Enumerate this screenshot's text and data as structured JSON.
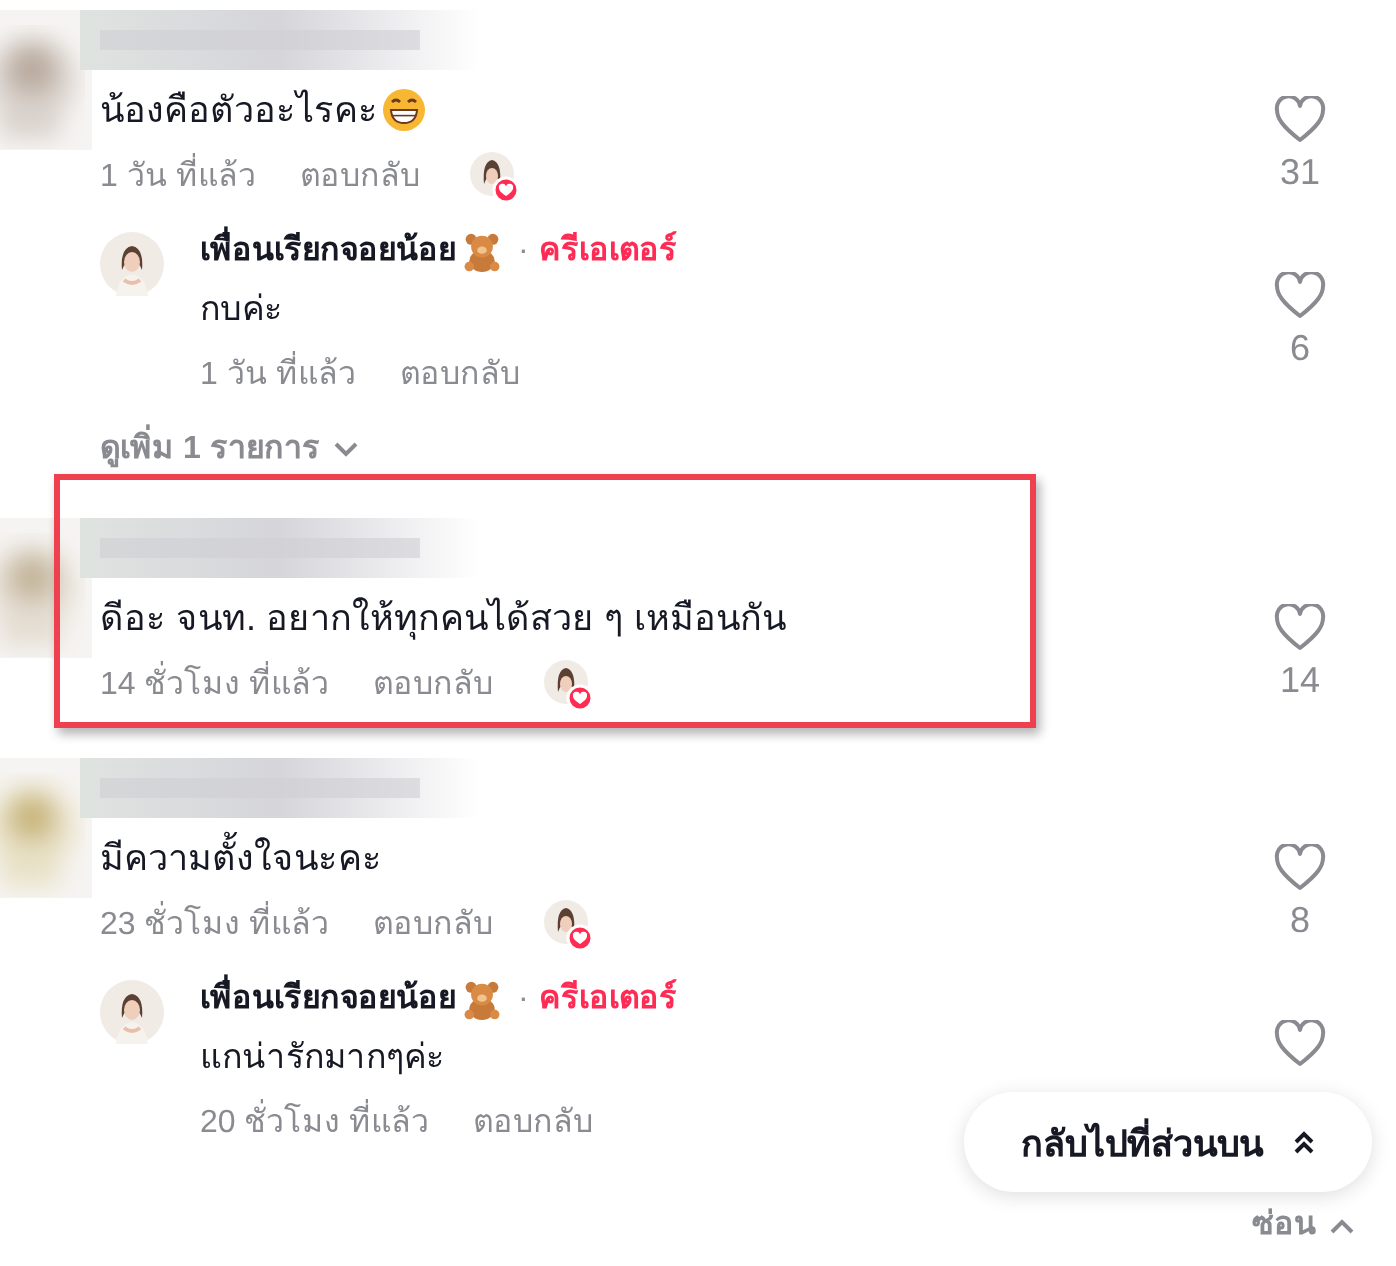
{
  "comments": [
    {
      "text": "น้องคือตัวอะไรคะ",
      "emoji": true,
      "time": "1 วัน ที่แล้ว",
      "reply_label": "ตอบกลับ",
      "liked_by_creator": true,
      "likes": "31",
      "highlighted": false,
      "replies": [
        {
          "author": "เพื่อนเรียกจอยน้อย",
          "author_emoji": true,
          "separator": "·",
          "badge": "ครีเอเตอร์",
          "text": "กบค่ะ",
          "time": "1 วัน ที่แล้ว",
          "reply_label": "ตอบกลับ",
          "likes": "6"
        }
      ],
      "more_replies": "ดูเพิ่ม 1 รายการ"
    },
    {
      "text": "ดีอะ จนท. อยากให้ทุกคนได้สวย ๆ เหมือนกัน",
      "emoji": false,
      "time": "14 ชั่วโมง ที่แล้ว",
      "reply_label": "ตอบกลับ",
      "liked_by_creator": true,
      "likes": "14",
      "highlighted": true
    },
    {
      "text": "มีความตั้งใจนะคะ",
      "emoji": false,
      "time": "23 ชั่วโมง ที่แล้ว",
      "reply_label": "ตอบกลับ",
      "liked_by_creator": true,
      "likes": "8",
      "highlighted": false,
      "replies": [
        {
          "author": "เพื่อนเรียกจอยน้อย",
          "author_emoji": true,
          "separator": "·",
          "badge": "ครีเอเตอร์",
          "text": "แกน่ารักมากๆค่ะ",
          "time": "20 ชั่วโมง ที่แล้ว",
          "reply_label": "ตอบกลับ"
        }
      ],
      "hide_replies": "ซ่อน"
    }
  ],
  "back_to_top": "กลับไปที่ส่วนบน"
}
